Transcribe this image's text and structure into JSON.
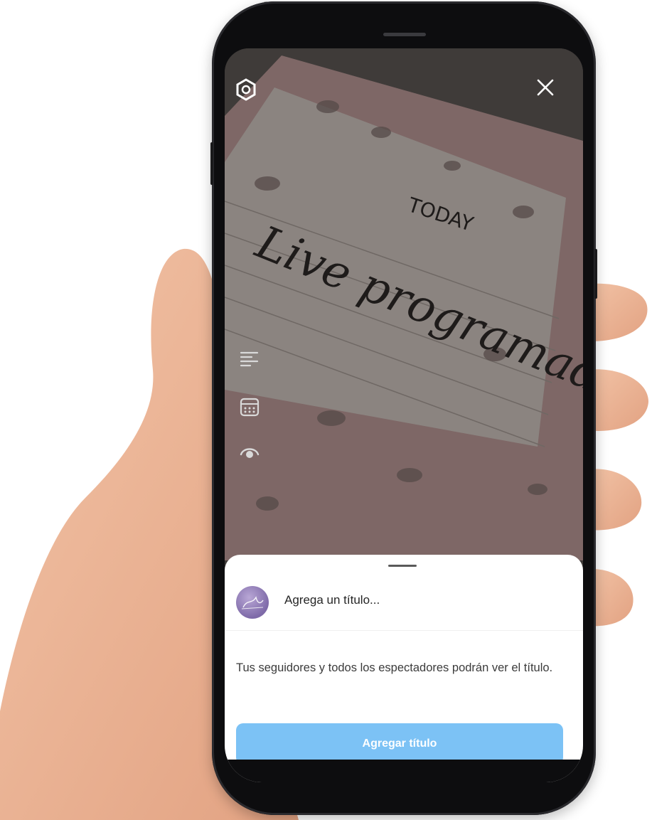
{
  "stories_caption_sheet": {
    "title_placeholder": "Agrega un título...",
    "info_text": "Tus seguidores y todos los espectadores podrán ver el título.",
    "add_button_label": "Agregar título"
  },
  "camera_overlay": {
    "top_icons": [
      "settings-icon",
      "close-icon"
    ],
    "side_tools": [
      "text-align-icon",
      "calendar-icon",
      "live-eye-icon"
    ]
  },
  "colors": {
    "button_bg": "#7cc2f5",
    "button_text": "#ffffff",
    "sheet_bg": "#ffffff",
    "overlay_dark": "#3e3a38"
  }
}
